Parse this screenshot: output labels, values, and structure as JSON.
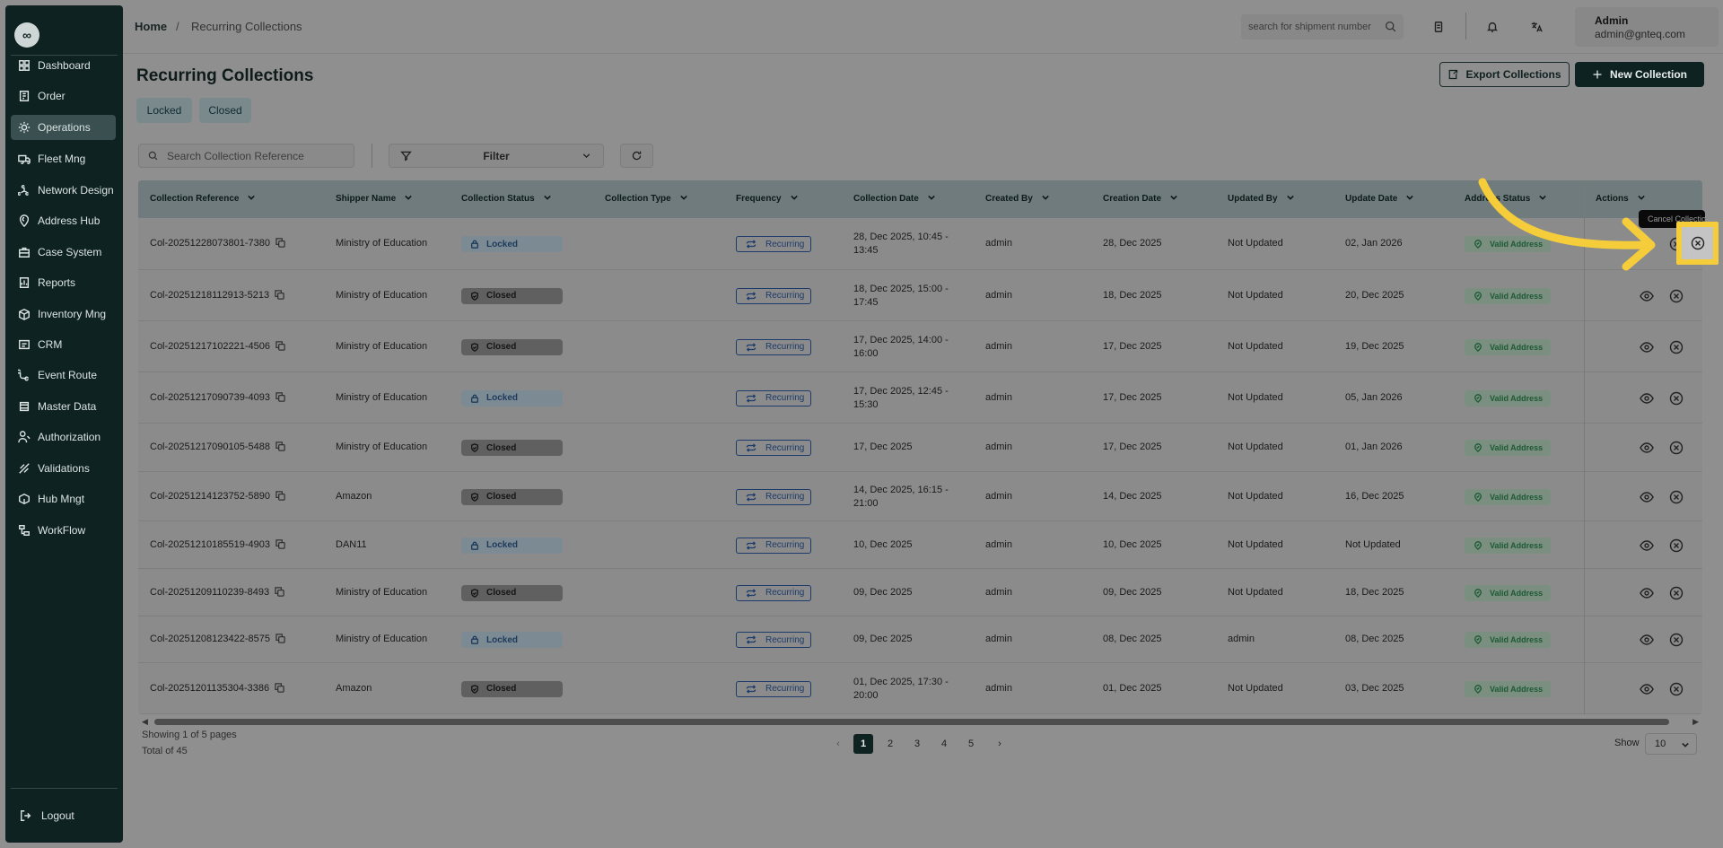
{
  "sidebar": {
    "logo": "∞",
    "items": [
      {
        "label": "Dashboard",
        "icon": "dashboard-icon"
      },
      {
        "label": "Order",
        "icon": "order-icon"
      },
      {
        "label": "Operations",
        "icon": "operations-icon",
        "active": true
      },
      {
        "label": "Fleet Mng",
        "icon": "truck-icon"
      },
      {
        "label": "Network Design",
        "icon": "network-icon"
      },
      {
        "label": "Address Hub",
        "icon": "map-pin-icon"
      },
      {
        "label": "Case System",
        "icon": "case-icon"
      },
      {
        "label": "Reports",
        "icon": "report-icon"
      },
      {
        "label": "Inventory Mng",
        "icon": "inventory-icon"
      },
      {
        "label": "CRM",
        "icon": "crm-icon"
      },
      {
        "label": "Event Route",
        "icon": "route-icon"
      },
      {
        "label": "Master Data",
        "icon": "database-icon"
      },
      {
        "label": "Authorization",
        "icon": "users-icon"
      },
      {
        "label": "Validations",
        "icon": "validation-icon"
      },
      {
        "label": "Hub Mngt",
        "icon": "hub-icon"
      },
      {
        "label": "WorkFlow",
        "icon": "workflow-icon"
      }
    ],
    "logout": "Logout"
  },
  "header": {
    "breadcrumb_home": "Home",
    "breadcrumb_sep": "/",
    "breadcrumb_current": "Recurring Collections",
    "search_placeholder": "search for shipment number",
    "user_name": "Admin",
    "user_email": "admin@gnteq.com"
  },
  "page": {
    "title": "Recurring Collections",
    "export_label": "Export Collections",
    "new_label": "New Collection",
    "tabs": [
      "Locked",
      "Closed"
    ],
    "search_placeholder": "Search Collection Reference",
    "filter_label": "Filter"
  },
  "table": {
    "columns": [
      "Collection Reference",
      "Shipper Name",
      "Collection Status",
      "Collection Type",
      "Frequency",
      "Collection Date",
      "Created By",
      "Creation Date",
      "Updated By",
      "Update Date",
      "Address Status",
      "Actions"
    ],
    "rows": [
      {
        "ref": "Col-20251228073801-7380",
        "shipper": "Ministry of Education",
        "status": "Locked",
        "frequency": "Recurring",
        "date1": "28, Dec 2025, 10:45 -",
        "date2": "13:45",
        "created_by": "admin",
        "creation_date": "28, Dec 2025",
        "updated_by": "Not Updated",
        "update_date": "02, Jan 2026",
        "address": "Valid Address"
      },
      {
        "ref": "Col-20251218112913-5213",
        "shipper": "Ministry of Education",
        "status": "Closed",
        "frequency": "Recurring",
        "date1": "18, Dec 2025, 15:00 -",
        "date2": "17:45",
        "created_by": "admin",
        "creation_date": "18, Dec 2025",
        "updated_by": "Not Updated",
        "update_date": "20, Dec 2025",
        "address": "Valid Address"
      },
      {
        "ref": "Col-20251217102221-4506",
        "shipper": "Ministry of Education",
        "status": "Closed",
        "frequency": "Recurring",
        "date1": "17, Dec 2025, 14:00 -",
        "date2": "16:00",
        "created_by": "admin",
        "creation_date": "17, Dec 2025",
        "updated_by": "Not Updated",
        "update_date": "19, Dec 2025",
        "address": "Valid Address"
      },
      {
        "ref": "Col-20251217090739-4093",
        "shipper": "Ministry of Education",
        "status": "Locked",
        "frequency": "Recurring",
        "date1": "17, Dec 2025, 12:45 -",
        "date2": "15:30",
        "created_by": "admin",
        "creation_date": "17, Dec 2025",
        "updated_by": "Not Updated",
        "update_date": "05, Jan 2026",
        "address": "Valid Address"
      },
      {
        "ref": "Col-20251217090105-5488",
        "shipper": "Ministry of Education",
        "status": "Closed",
        "frequency": "Recurring",
        "date1": "17, Dec 2025",
        "date2": "",
        "created_by": "admin",
        "creation_date": "17, Dec 2025",
        "updated_by": "Not Updated",
        "update_date": "01, Jan 2026",
        "address": "Valid Address"
      },
      {
        "ref": "Col-20251214123752-5890",
        "shipper": "Amazon",
        "status": "Closed",
        "frequency": "Recurring",
        "date1": "14, Dec 2025, 16:15 -",
        "date2": "21:00",
        "created_by": "admin",
        "creation_date": "14, Dec 2025",
        "updated_by": "Not Updated",
        "update_date": "16, Dec 2025",
        "address": "Valid Address"
      },
      {
        "ref": "Col-20251210185519-4903",
        "shipper": "DAN11",
        "status": "Locked",
        "frequency": "Recurring",
        "date1": "10, Dec 2025",
        "date2": "",
        "created_by": "admin",
        "creation_date": "10, Dec 2025",
        "updated_by": "Not Updated",
        "update_date": "Not Updated",
        "address": "Valid Address"
      },
      {
        "ref": "Col-20251209110239-8493",
        "shipper": "Ministry of Education",
        "status": "Closed",
        "frequency": "Recurring",
        "date1": "09, Dec 2025",
        "date2": "",
        "created_by": "admin",
        "creation_date": "09, Dec 2025",
        "updated_by": "Not Updated",
        "update_date": "18, Dec 2025",
        "address": "Valid Address"
      },
      {
        "ref": "Col-20251208123422-8575",
        "shipper": "Ministry of Education",
        "status": "Locked",
        "frequency": "Recurring",
        "date1": "09, Dec 2025",
        "date2": "",
        "created_by": "admin",
        "creation_date": "08, Dec 2025",
        "updated_by": "admin",
        "update_date": "08, Dec 2025",
        "address": "Valid Address"
      },
      {
        "ref": "Col-20251201135304-3386",
        "shipper": "Amazon",
        "status": "Closed",
        "frequency": "Recurring",
        "date1": "01, Dec 2025, 17:30 -",
        "date2": "20:00",
        "created_by": "admin",
        "creation_date": "01, Dec 2025",
        "updated_by": "Not Updated",
        "update_date": "03, Dec 2025",
        "address": "Valid Address"
      }
    ]
  },
  "pagination": {
    "showing": "Showing 1 of 5 pages",
    "total": "Total of 45",
    "pages": [
      "1",
      "2",
      "3",
      "4",
      "5"
    ],
    "current": "1",
    "prev": "‹",
    "next": "›",
    "show_label": "Show",
    "show_value": "10"
  },
  "tooltip": {
    "text": "Cancel Collection"
  },
  "colors": {
    "sidebar": "#0f2222",
    "highlight": "#f5cd3a",
    "primary": "#0f2222"
  }
}
